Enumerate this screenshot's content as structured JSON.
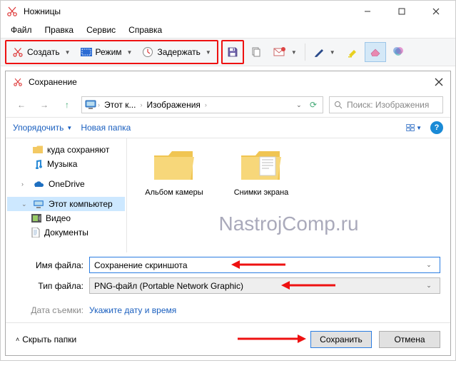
{
  "app": {
    "title": "Ножницы"
  },
  "menu": {
    "file": "Файл",
    "edit": "Правка",
    "tools": "Сервис",
    "help": "Справка"
  },
  "toolbar": {
    "new_label": "Создать",
    "mode_label": "Режим",
    "delay_label": "Задержать"
  },
  "dialog": {
    "title": "Сохранение",
    "breadcrumb": {
      "seg1": "Этот к...",
      "seg2": "Изображения"
    },
    "search_placeholder": "Поиск: Изображения",
    "organize_label": "Упорядочить",
    "newfolder_label": "Новая папка",
    "tree": {
      "item0": "куда сохраняют",
      "item1": "Музыка",
      "item2": "OneDrive",
      "item3": "Этот компьютер",
      "item4": "Видео",
      "item5": "Документы"
    },
    "folders": {
      "f0": "Альбом камеры",
      "f1": "Снимки экрана"
    },
    "fields": {
      "name_label": "Имя файла:",
      "name_value": "Сохранение скриншота",
      "type_label": "Тип файла:",
      "type_value": "PNG-файл (Portable Network Graphic)",
      "date_label": "Дата съемки:",
      "date_link": "Укажите дату и время"
    },
    "footer": {
      "hide_label": "Скрыть папки",
      "save_label": "Сохранить",
      "cancel_label": "Отмена"
    }
  },
  "watermark": "NastrojComp.ru"
}
